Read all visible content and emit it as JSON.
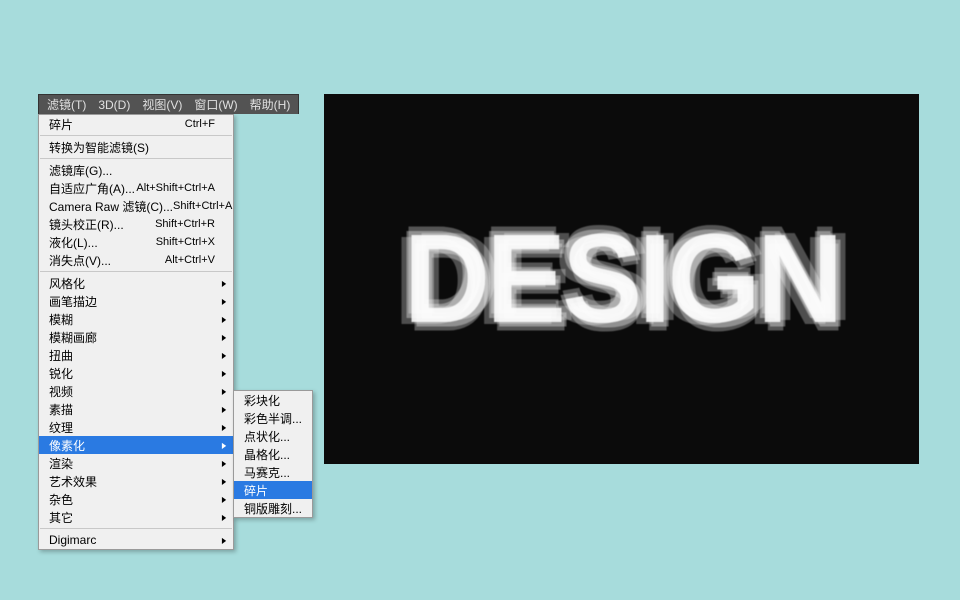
{
  "menubar": {
    "items": [
      {
        "label": "滤镜(T)"
      },
      {
        "label": "3D(D)"
      },
      {
        "label": "视图(V)"
      },
      {
        "label": "窗口(W)"
      },
      {
        "label": "帮助(H)"
      }
    ]
  },
  "menu": {
    "groups": [
      [
        {
          "label": "碎片",
          "shortcut": "Ctrl+F"
        }
      ],
      [
        {
          "label": "转换为智能滤镜(S)"
        }
      ],
      [
        {
          "label": "滤镜库(G)..."
        },
        {
          "label": "自适应广角(A)...",
          "shortcut": "Alt+Shift+Ctrl+A"
        },
        {
          "label": "Camera Raw 滤镜(C)...",
          "shortcut": "Shift+Ctrl+A"
        },
        {
          "label": "镜头校正(R)...",
          "shortcut": "Shift+Ctrl+R"
        },
        {
          "label": "液化(L)...",
          "shortcut": "Shift+Ctrl+X"
        },
        {
          "label": "消失点(V)...",
          "shortcut": "Alt+Ctrl+V"
        }
      ],
      [
        {
          "label": "风格化",
          "sub": true
        },
        {
          "label": "画笔描边",
          "sub": true
        },
        {
          "label": "模糊",
          "sub": true
        },
        {
          "label": "模糊画廊",
          "sub": true
        },
        {
          "label": "扭曲",
          "sub": true
        },
        {
          "label": "锐化",
          "sub": true
        },
        {
          "label": "视频",
          "sub": true
        },
        {
          "label": "素描",
          "sub": true
        },
        {
          "label": "纹理",
          "sub": true
        },
        {
          "label": "像素化",
          "sub": true,
          "selected": true
        },
        {
          "label": "渲染",
          "sub": true
        },
        {
          "label": "艺术效果",
          "sub": true
        },
        {
          "label": "杂色",
          "sub": true
        },
        {
          "label": "其它",
          "sub": true
        }
      ],
      [
        {
          "label": "Digimarc",
          "sub": true
        }
      ]
    ]
  },
  "submenu": {
    "items": [
      {
        "label": "彩块化"
      },
      {
        "label": "彩色半调..."
      },
      {
        "label": "点状化..."
      },
      {
        "label": "晶格化..."
      },
      {
        "label": "马赛克..."
      },
      {
        "label": "碎片",
        "selected": true
      },
      {
        "label": "铜版雕刻..."
      }
    ]
  },
  "canvas": {
    "text": "DESIGN"
  }
}
